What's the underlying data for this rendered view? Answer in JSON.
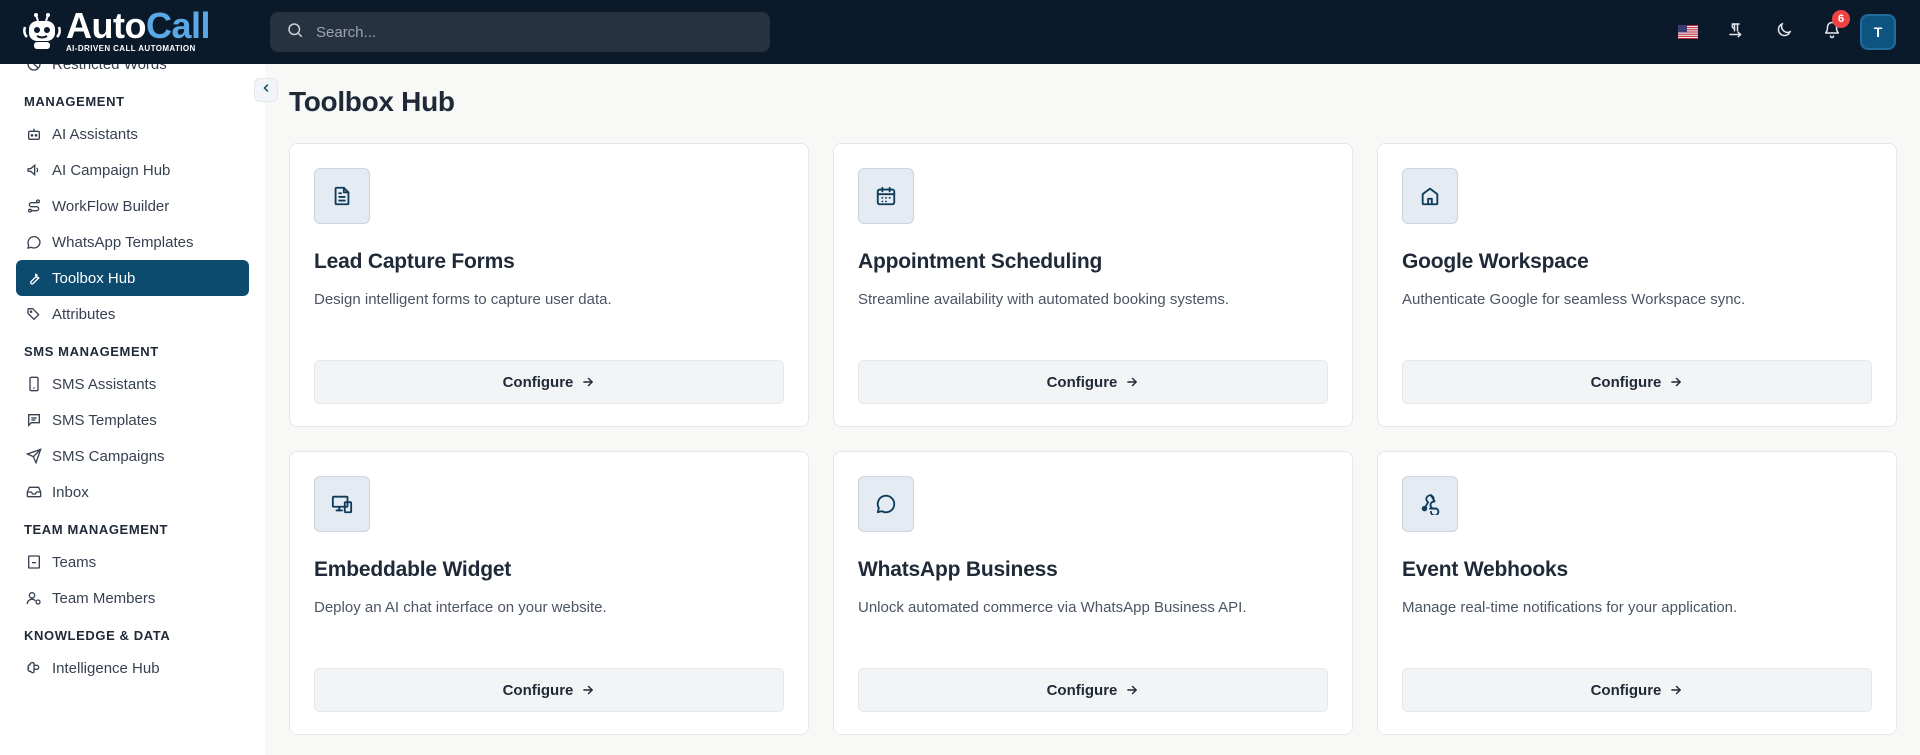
{
  "app": {
    "name_part1": "Auto",
    "name_part2": "Call",
    "tagline": "AI-DRIVEN CALL AUTOMATION"
  },
  "search": {
    "placeholder": "Search..."
  },
  "header": {
    "notifications_count": "6",
    "avatar_initial": "T",
    "language_flag": "us-flag-icon"
  },
  "sidebar": {
    "partial_item": "Restricted Words",
    "sections": [
      {
        "title": "MANAGEMENT",
        "items": [
          {
            "label": "AI Assistants",
            "icon": "bot-icon"
          },
          {
            "label": "AI Campaign Hub",
            "icon": "megaphone-icon"
          },
          {
            "label": "WorkFlow Builder",
            "icon": "route-icon"
          },
          {
            "label": "WhatsApp Templates",
            "icon": "chat-icon"
          },
          {
            "label": "Toolbox Hub",
            "icon": "wrench-icon",
            "active": true
          },
          {
            "label": "Attributes",
            "icon": "tags-icon"
          }
        ]
      },
      {
        "title": "SMS MANAGEMENT",
        "items": [
          {
            "label": "SMS Assistants",
            "icon": "phone-icon"
          },
          {
            "label": "SMS Templates",
            "icon": "message-text-icon"
          },
          {
            "label": "SMS Campaigns",
            "icon": "send-icon"
          },
          {
            "label": "Inbox",
            "icon": "inbox-icon"
          }
        ]
      },
      {
        "title": "TEAM MANAGEMENT",
        "items": [
          {
            "label": "Teams",
            "icon": "building-icon"
          },
          {
            "label": "Team Members",
            "icon": "user-cog-icon"
          }
        ]
      },
      {
        "title": "KNOWLEDGE & DATA",
        "items": [
          {
            "label": "Intelligence Hub",
            "icon": "brain-icon"
          }
        ]
      }
    ]
  },
  "main": {
    "title": "Toolbox Hub",
    "cards": [
      {
        "title": "Lead Capture Forms",
        "description": "Design intelligent forms to capture user data.",
        "button": "Configure",
        "icon": "document-icon"
      },
      {
        "title": "Appointment Scheduling",
        "description": "Streamline availability with automated booking systems.",
        "button": "Configure",
        "icon": "calendar-icon"
      },
      {
        "title": "Google Workspace",
        "description": "Authenticate Google for seamless Workspace sync.",
        "button": "Configure",
        "icon": "home-icon"
      },
      {
        "title": "Embeddable Widget",
        "description": "Deploy an AI chat interface on your website.",
        "button": "Configure",
        "icon": "devices-icon"
      },
      {
        "title": "WhatsApp Business",
        "description": "Unlock automated commerce via WhatsApp Business API.",
        "button": "Configure",
        "icon": "message-circle-icon"
      },
      {
        "title": "Event Webhooks",
        "description": "Manage real-time notifications for your application.",
        "button": "Configure",
        "icon": "webhook-icon"
      }
    ]
  },
  "colors": {
    "topbar": "#0b1a2b",
    "accent": "#0c4a6e",
    "brand_blue": "#5aa9e6",
    "badge": "#ef4444"
  }
}
